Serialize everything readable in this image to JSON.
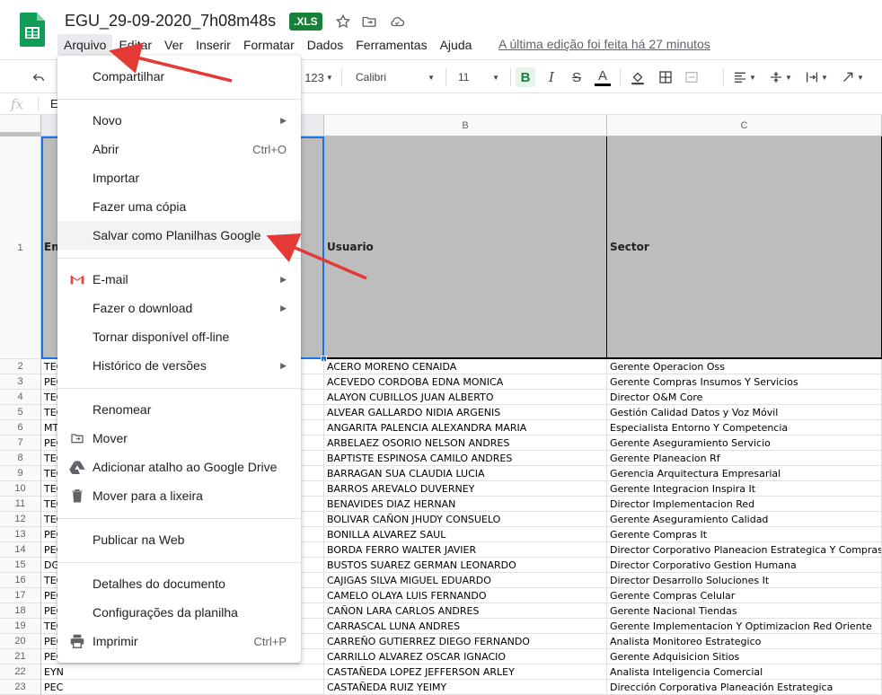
{
  "header": {
    "title": "EGU_29-09-2020_7h08m48s",
    "badge": ".XLS",
    "last_edit": "A última edição foi feita há 27 minutos",
    "icons": [
      "star-icon",
      "move-folder-icon",
      "cloud-status-icon"
    ]
  },
  "menubar": [
    "Arquivo",
    "Editar",
    "Ver",
    "Inserir",
    "Formatar",
    "Dados",
    "Ferramentas",
    "Ajuda"
  ],
  "toolbar": {
    "number_format": "123",
    "font": "Calibri",
    "font_size": "11",
    "bold": "B",
    "italic": "I",
    "strike": "S",
    "text_color": "A"
  },
  "formula_bar": {
    "fx": "fx",
    "value": "E"
  },
  "columns": [
    "B",
    "C"
  ],
  "header_row": {
    "a": "Em",
    "b": "Usuario",
    "c": "Sector"
  },
  "rows": [
    {
      "n": "2",
      "a": "TEC",
      "b": "ACERO MORENO CENAIDA",
      "c": "Gerente Operacion Oss"
    },
    {
      "n": "3",
      "a": "PEC",
      "b": "ACEVEDO CORDOBA EDNA MONICA",
      "c": "Gerente Compras Insumos Y Servicios"
    },
    {
      "n": "4",
      "a": "TEC",
      "b": "ALAYON CUBILLOS JUAN ALBERTO",
      "c": "Director O&M Core"
    },
    {
      "n": "5",
      "a": "TEC",
      "b": "ALVEAR GALLARDO NIDIA ARGENIS",
      "c": "Gestión Calidad Datos y Voz Móvil"
    },
    {
      "n": "6",
      "a": "MT",
      "b": "ANGARITA PALENCIA ALEXANDRA MARIA",
      "c": "Especialista Entorno Y Competencia"
    },
    {
      "n": "7",
      "a": "PEC",
      "b": "ARBELAEZ OSORIO NELSON ANDRES",
      "c": "Gerente Aseguramiento Servicio"
    },
    {
      "n": "8",
      "a": "TEC",
      "b": "BAPTISTE ESPINOSA CAMILO ANDRES",
      "c": "Gerente Planeacion Rf"
    },
    {
      "n": "9",
      "a": "TEC",
      "b": "BARRAGAN SUA CLAUDIA LUCIA",
      "c": "Gerencia Arquitectura Empresarial"
    },
    {
      "n": "10",
      "a": "TEC",
      "b": "BARROS AREVALO DUVERNEY",
      "c": "Gerente Integracion Inspira It"
    },
    {
      "n": "11",
      "a": "TEC",
      "b": "BENAVIDES DIAZ HERNAN",
      "c": "Director Implementacion Red"
    },
    {
      "n": "12",
      "a": "TEC",
      "b": "BOLIVAR CAÑON JHUDY CONSUELO",
      "c": "Gerente Aseguramiento Calidad"
    },
    {
      "n": "13",
      "a": "PEC",
      "b": "BONILLA ALVAREZ SAUL",
      "c": "Gerente Compras It"
    },
    {
      "n": "14",
      "a": "PEC",
      "b": "BORDA FERRO WALTER JAVIER",
      "c": "Director Corporativo Planeacion Estrategica Y Compras"
    },
    {
      "n": "15",
      "a": "DG",
      "b": "BUSTOS SUAREZ GERMAN LEONARDO",
      "c": "Director Corporativo Gestion Humana"
    },
    {
      "n": "16",
      "a": "TEC",
      "b": "CAJIGAS SILVA MIGUEL EDUARDO",
      "c": "Director Desarrollo Soluciones It"
    },
    {
      "n": "17",
      "a": "PEC",
      "b": "CAMELO OLAYA LUIS FERNANDO",
      "c": "Gerente Compras Celular"
    },
    {
      "n": "18",
      "a": "PEC",
      "b": "CAÑON LARA CARLOS ANDRES",
      "c": "Gerente Nacional Tiendas"
    },
    {
      "n": "19",
      "a": "TEC",
      "b": "CARRASCAL LUNA ANDRES",
      "c": "Gerente Implementacion Y Optimizacion Red Oriente"
    },
    {
      "n": "20",
      "a": "PEC",
      "b": "CARREÑO GUTIERREZ DIEGO FERNANDO",
      "c": "Analista Monitoreo Estrategico"
    },
    {
      "n": "21",
      "a": "PEC",
      "b": "CARRILLO ALVAREZ OSCAR IGNACIO",
      "c": "Gerente Adquisicion Sitios"
    },
    {
      "n": "22",
      "a": "EYN",
      "b": "CASTAÑEDA LOPEZ JEFFERSON ARLEY",
      "c": "Analista Inteligencia Comercial"
    },
    {
      "n": "23",
      "a": "PEC",
      "b": "CASTAÑEDA RUIZ YEIMY",
      "c": "Dirección Corporativa Planeación Estrategica"
    }
  ],
  "file_menu": [
    {
      "label": "Compartilhar",
      "shortcut": "",
      "submenu": false,
      "icon": ""
    },
    {
      "label": "Novo",
      "shortcut": "",
      "submenu": true,
      "icon": ""
    },
    {
      "label": "Abrir",
      "shortcut": "Ctrl+O",
      "submenu": false,
      "icon": ""
    },
    {
      "label": "Importar",
      "shortcut": "",
      "submenu": false,
      "icon": ""
    },
    {
      "label": "Fazer uma cópia",
      "shortcut": "",
      "submenu": false,
      "icon": ""
    },
    {
      "label": "Salvar como Planilhas Google",
      "shortcut": "",
      "submenu": false,
      "icon": ""
    },
    {
      "label": "E-mail",
      "shortcut": "",
      "submenu": true,
      "icon": "gmail-icon"
    },
    {
      "label": "Fazer o download",
      "shortcut": "",
      "submenu": true,
      "icon": ""
    },
    {
      "label": "Tornar disponível off-line",
      "shortcut": "",
      "submenu": false,
      "icon": ""
    },
    {
      "label": "Histórico de versões",
      "shortcut": "",
      "submenu": true,
      "icon": ""
    },
    {
      "label": "Renomear",
      "shortcut": "",
      "submenu": false,
      "icon": ""
    },
    {
      "label": "Mover",
      "shortcut": "",
      "submenu": false,
      "icon": "move-folder-icon"
    },
    {
      "label": "Adicionar atalho ao Google Drive",
      "shortcut": "",
      "submenu": false,
      "icon": "drive-shortcut-icon"
    },
    {
      "label": "Mover para a lixeira",
      "shortcut": "",
      "submenu": false,
      "icon": "trash-icon"
    },
    {
      "label": "Publicar na Web",
      "shortcut": "",
      "submenu": false,
      "icon": ""
    },
    {
      "label": "Detalhes do documento",
      "shortcut": "",
      "submenu": false,
      "icon": ""
    },
    {
      "label": "Configurações da planilha",
      "shortcut": "",
      "submenu": false,
      "icon": ""
    },
    {
      "label": "Imprimir",
      "shortcut": "Ctrl+P",
      "submenu": false,
      "icon": "print-icon"
    }
  ],
  "colors": {
    "accent": "#188038",
    "annotation": "#e53935",
    "header_fill": "#bdbdbd"
  }
}
